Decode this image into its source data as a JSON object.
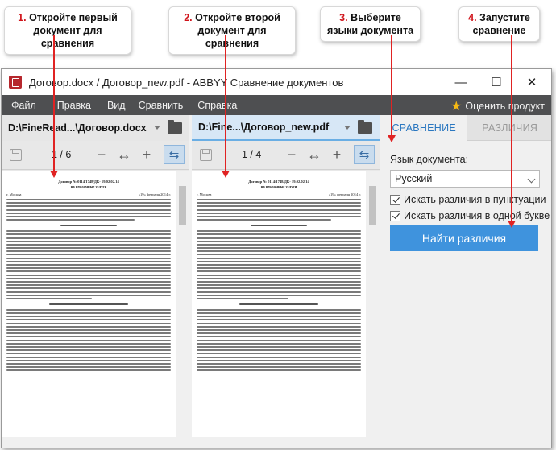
{
  "callouts": [
    {
      "num": "1.",
      "text": "Откройте первый документ для сравнения"
    },
    {
      "num": "2.",
      "text": "Откройте второй документ для сравнения"
    },
    {
      "num": "3.",
      "text": "Выберите языки документа"
    },
    {
      "num": "4.",
      "text": "Запустите сравнение"
    }
  ],
  "window": {
    "title": "Договор.docx / Договор_new.pdf - ABBYY Сравнение документов",
    "minimize": "—",
    "maximize": "☐",
    "close": "✕"
  },
  "menu": {
    "items": [
      "Файл",
      "Правка",
      "Вид",
      "Сравнить",
      "Справка"
    ],
    "rate_label": "Оценить продукт"
  },
  "left_pane": {
    "path": "D:\\FineRead...\\Договор.docx",
    "page": "1 / 6"
  },
  "mid_pane": {
    "path": "D:\\Fine...\\Договор_new.pdf",
    "page": "1 / 4"
  },
  "document": {
    "title_line1": "Договор № 0114/1748/ДК- 19.02.02.14",
    "title_line2": "на рекламные услуги",
    "city": "г. Москва",
    "date": "«19» февраля 2014 г."
  },
  "side_panel": {
    "tab_compare": "СРАВНЕНИЕ",
    "tab_differences": "РАЗЛИЧИЯ",
    "lang_label": "Язык документа:",
    "lang_value": "Русский",
    "cb_punct": "Искать различия в пунктуации",
    "cb_letter": "Искать различия в одной букве",
    "find_button": "Найти различия"
  },
  "colors": {
    "accent": "#3f93dd",
    "callout_number": "#d0131a",
    "pointer": "#e02323",
    "menubar": "#4e4f51"
  }
}
